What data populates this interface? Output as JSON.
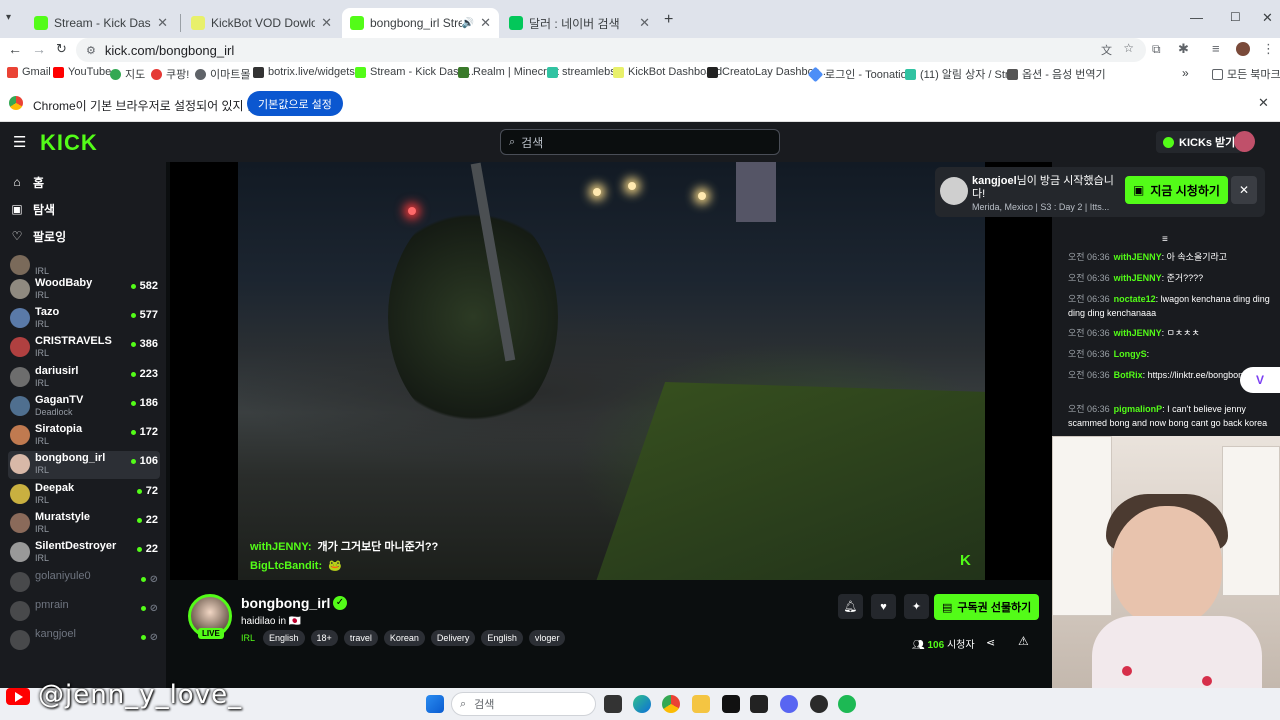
{
  "browser": {
    "tabs": [
      {
        "label": "Stream - Kick Dashboard",
        "active": false
      },
      {
        "label": "KickBot VOD Dowloader",
        "active": false
      },
      {
        "label": "bongbong_irl Stream - Wa",
        "active": true
      },
      {
        "label": "달러 : 네이버 검색",
        "active": false
      }
    ],
    "new_tab": "+",
    "url": "kick.com/bongbong_irl",
    "bookmarks": [
      "Gmail",
      "YouTube",
      "지도",
      "쿠팡!",
      "이마트몰",
      "botrix.live/widgets/...",
      "Stream - Kick Dash...",
      "Realm | Minecraft",
      "streamlebs",
      "KickBot Dashboard",
      "CreatoLay Dashboa...",
      "로그인 - Toonation",
      "(11) 알림 상자 / Str...",
      "옵션 - 음성 번역기"
    ],
    "bookmarks_more": "»",
    "all_bookmarks": "모든 북마크",
    "infobar_text": "Chrome이 기본 브라우저로 설정되어 있지 않습니다",
    "infobar_button": "기본값으로 설정"
  },
  "kick": {
    "logo": "KICK",
    "search_placeholder": "검색",
    "kicks_button": "KICKs 받기",
    "nav": [
      {
        "icon": "home-icon",
        "glyph": "⌂",
        "label": "홈"
      },
      {
        "icon": "browse-icon",
        "glyph": "▣",
        "label": "탐색"
      },
      {
        "icon": "heart-icon",
        "glyph": "♡",
        "label": "팔로잉"
      }
    ],
    "channels": [
      {
        "name": "",
        "category": "IRL",
        "viewers": "",
        "color": "#7a6a5a"
      },
      {
        "name": "WoodBaby",
        "category": "IRL",
        "viewers": "582",
        "color": "#8f8a80"
      },
      {
        "name": "Tazo",
        "category": "IRL",
        "viewers": "577",
        "color": "#5a7aa8"
      },
      {
        "name": "CRISTRAVELS",
        "category": "IRL",
        "viewers": "386",
        "color": "#b04040"
      },
      {
        "name": "dariusirl",
        "category": "IRL",
        "viewers": "223",
        "color": "#6d6d6d"
      },
      {
        "name": "GaganTV",
        "category": "Deadlock",
        "viewers": "186",
        "color": "#4f6f8f"
      },
      {
        "name": "Siratopia",
        "category": "IRL",
        "viewers": "172",
        "color": "#c07a50"
      },
      {
        "name": "bongbong_irl",
        "category": "IRL",
        "viewers": "106",
        "color": "#d8b8a8"
      },
      {
        "name": "Deepak",
        "category": "IRL",
        "viewers": "72",
        "color": "#c9b040"
      },
      {
        "name": "Muratstyle",
        "category": "IRL",
        "viewers": "22",
        "color": "#8a6a5a"
      },
      {
        "name": "SilentDestroyer",
        "category": "IRL",
        "viewers": "22",
        "color": "#999999"
      },
      {
        "name": "golaniyule0",
        "category": "",
        "viewers": "",
        "color": "#777777"
      },
      {
        "name": "pmrain",
        "category": "",
        "viewers": "",
        "color": "#777777"
      },
      {
        "name": "kangjoel",
        "category": "",
        "viewers": "",
        "color": "#777777"
      }
    ],
    "overlay_chat": [
      {
        "user": "withJENNY:",
        "text": "개가 그거보단 마니준거??"
      },
      {
        "user": "BigLtcBandit:",
        "text": "🐸"
      }
    ],
    "stream": {
      "channel_name": "bongbong_irl",
      "title": "haidilao in 🇯🇵",
      "category": "IRL",
      "tags": [
        "English",
        "18+",
        "travel",
        "Korean",
        "Delivery",
        "English",
        "vloger"
      ],
      "live_label": "LIVE",
      "gift_button": "구독권 선물하기",
      "viewers_count": "106",
      "viewers_label": "시청자"
    },
    "notification": {
      "user": "kangjoel",
      "text": "님이 방금 시작했습니다!",
      "subtitle": "Merida, Mexico | S3 : Day 2 | Itts...",
      "watch_button": "지금 시청하기",
      "close": "✕"
    },
    "chat": [
      {
        "time": "오전 06:36",
        "user": "withJENNY",
        "text": ": 아 속소올기라고"
      },
      {
        "time": "오전 06:36",
        "user": "withJENNY",
        "text": ": 준거????"
      },
      {
        "time": "오전 06:36",
        "user": "noctate12",
        "text": ": lwagon kenchana ding ding ding ding kenchanaaa"
      },
      {
        "time": "오전 06:36",
        "user": "withJENNY",
        "text": ": ㅁㅊㅊㅊ"
      },
      {
        "time": "오전 06:36",
        "user": "LongyS",
        "text": ":"
      },
      {
        "time": "오전 06:36",
        "user": "BotRix",
        "text": ": https://linktr.ee/bongbong_irl"
      },
      {
        "time": "오전 06:36",
        "user": "pigmalionP",
        "text": ": I can't believe jenny scammed bong and now bong cant go back korea"
      }
    ]
  },
  "taskbar": {
    "search_placeholder": "검색",
    "watermark": "@jenn_y_love_"
  }
}
